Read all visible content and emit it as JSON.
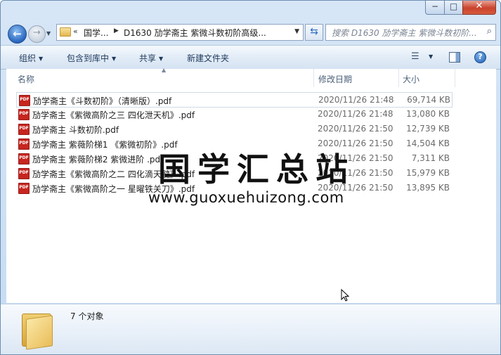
{
  "window": {
    "caption": {
      "minimize": "−",
      "maximize": "□",
      "close": "✕"
    }
  },
  "nav": {
    "back_icon": "←",
    "forward_icon": "→",
    "history_icon": "▼"
  },
  "address": {
    "overflow": "«",
    "crumb1": "国学...",
    "separator": "▶",
    "crumb2": "D1630 劢学斋主 紫微斗数初阶高级...",
    "dropdown": "▼"
  },
  "refresh_icon": "⇆",
  "search": {
    "placeholder": "搜索 D1630 劢学斋主 紫微斗数初阶...",
    "icon": "⌕"
  },
  "toolbar": {
    "organize": "组织",
    "include_in_library": "包含到库中",
    "share": "共享",
    "new_folder": "新建文件夹",
    "arrow": "▼",
    "view_icon": "☰",
    "help": "?"
  },
  "columns": {
    "name": "名称",
    "modified": "修改日期",
    "size": "大小",
    "sort_arrow": "▲"
  },
  "files": [
    {
      "name": "劢学斋主《斗数初阶》（清晰版）.pdf",
      "date": "2020/11/26 21:48",
      "size": "69,714 KB",
      "icon": "PDF"
    },
    {
      "name": "劢学斋主《紫微高阶之三 四化泄天机》.pdf",
      "date": "2020/11/26 21:48",
      "size": "13,080 KB",
      "icon": "PDF"
    },
    {
      "name": "劢学斋主 斗数初阶.pdf",
      "date": "2020/11/26 21:50",
      "size": "12,739 KB",
      "icon": "PDF"
    },
    {
      "name": "劢学斋主 紫薇阶梯1 《紫微初阶》.pdf",
      "date": "2020/11/26 21:50",
      "size": "14,504 KB",
      "icon": "PDF"
    },
    {
      "name": "劢学斋主 紫薇阶梯2 紫微进阶 .pdf",
      "date": "2020/11/26 21:50",
      "size": "7,311 KB",
      "icon": "PDF"
    },
    {
      "name": "劢学斋主《紫微高阶之二 四化滴天髓》.pdf",
      "date": "2020/11/26 21:50",
      "size": "15,979 KB",
      "icon": "PDF"
    },
    {
      "name": "劢学斋主《紫微高阶之一 星曜铁关刀》.pdf",
      "date": "2020/11/26 21:50",
      "size": "13,895 KB",
      "icon": "PDF"
    }
  ],
  "watermark": {
    "title": "国学汇总站",
    "url": "www.guoxuehuizong.com"
  },
  "status": {
    "count": "7 个对象"
  }
}
